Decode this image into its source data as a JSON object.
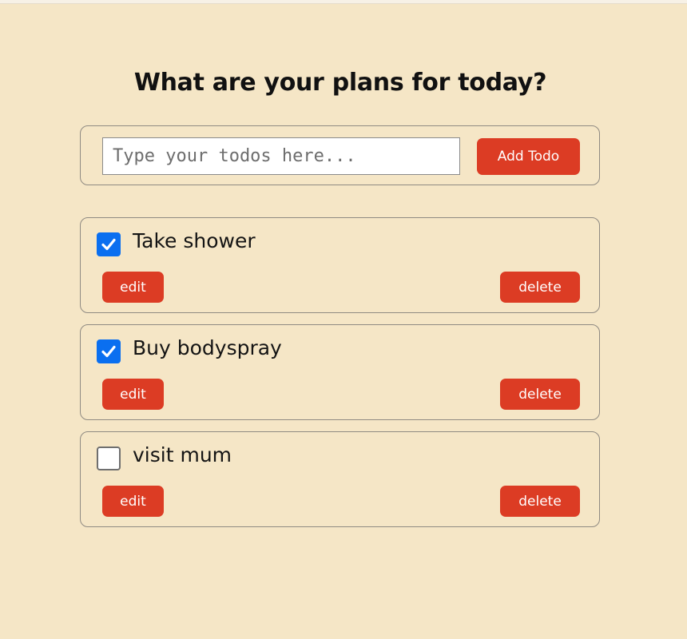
{
  "header": {
    "title": "What are your plans for today?"
  },
  "form": {
    "placeholder": "Type your todos here...",
    "value": "",
    "add_label": "Add Todo"
  },
  "todos": [
    {
      "text": "Take shower",
      "checked": true,
      "edit_label": "edit",
      "delete_label": "delete"
    },
    {
      "text": "Buy bodyspray",
      "checked": true,
      "edit_label": "edit",
      "delete_label": "delete"
    },
    {
      "text": "visit mum",
      "checked": false,
      "edit_label": "edit",
      "delete_label": "delete"
    }
  ],
  "colors": {
    "background": "#f5e6c6",
    "button": "#dc3c24",
    "checkbox_checked": "#0a6ff0",
    "border": "#8f8a82"
  },
  "icons": {
    "checked": "checkbox-checked-icon",
    "unchecked": "checkbox-unchecked-icon"
  }
}
